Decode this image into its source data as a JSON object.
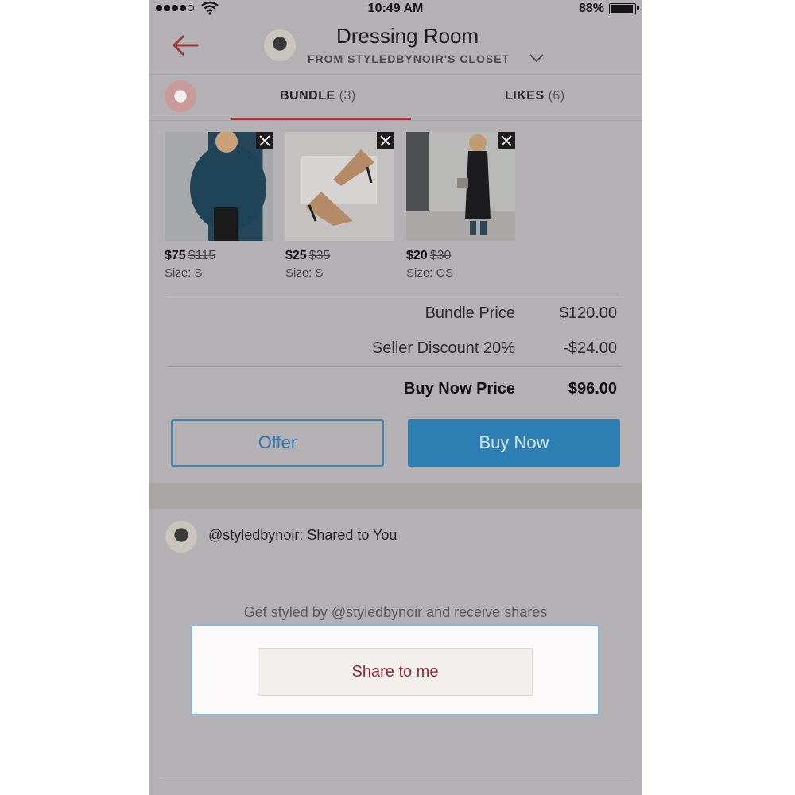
{
  "status_bar": {
    "time": "10:49 AM",
    "battery": "88%"
  },
  "header": {
    "title": "Dressing Room",
    "subtitle": "FROM STYLEDBYNOIR'S CLOSET"
  },
  "tabs": [
    {
      "label": "BUNDLE",
      "count": "(3)",
      "active": true
    },
    {
      "label": "LIKES",
      "count": "(6)",
      "active": false
    }
  ],
  "items": [
    {
      "price": "$75",
      "original_price": "$115",
      "size": "Size: S"
    },
    {
      "price": "$25",
      "original_price": "$35",
      "size": "Size: S"
    },
    {
      "price": "$20",
      "original_price": "$30",
      "size": "Size: OS"
    }
  ],
  "summary": {
    "bundle_label": "Bundle Price",
    "bundle_value": "$120.00",
    "discount_label": "Seller Discount 20%",
    "discount_value": "-$24.00",
    "buy_now_label": "Buy Now Price",
    "buy_now_value": "$96.00"
  },
  "actions": {
    "offer": "Offer",
    "buy_now": "Buy Now"
  },
  "shared": {
    "heading": "@styledbynoir: Shared to You",
    "prompt": "Get styled by @styledbynoir and receive shares",
    "share_button": "Share to me"
  },
  "colors": {
    "accent": "#9b3a3e",
    "primary_blue": "#2e7fb3",
    "overlay_gray": "#b3b1b3"
  }
}
